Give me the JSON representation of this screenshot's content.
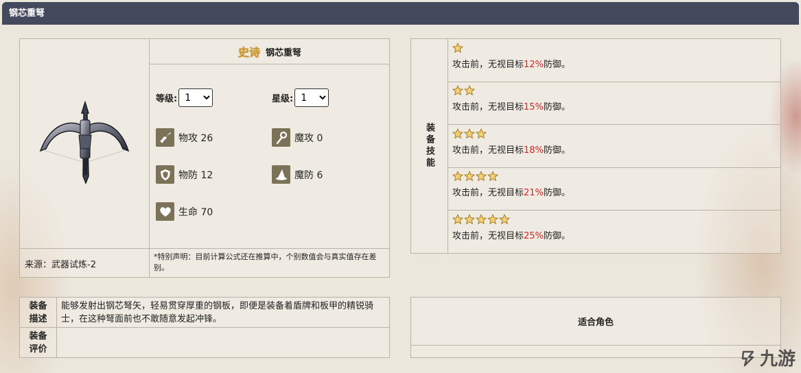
{
  "header": {
    "title": "钢芯重弩"
  },
  "weapon": {
    "rarity_label": "史诗",
    "name": "钢芯重弩",
    "level_label": "等级:",
    "level_value": "1",
    "star_label": "星级:",
    "star_value": "1",
    "stats": [
      {
        "icon": "sword-icon",
        "label": "物攻 26"
      },
      {
        "icon": "staff-icon",
        "label": "魔攻 0"
      },
      {
        "icon": "shield-icon",
        "label": "物防 12"
      },
      {
        "icon": "wizard-hat-icon",
        "label": "魔防 6"
      },
      {
        "icon": "heart-icon",
        "label": "生命 70"
      }
    ],
    "source": "来源：武器试炼-2",
    "note": "*特别声明：目前计算公式还在推算中，个别数值会与真实值存在差别。"
  },
  "skills": {
    "heading": "装备技能",
    "items": [
      {
        "stars": 1,
        "prefix": "攻击前，无视目标",
        "value": "12%",
        "suffix": "防御。"
      },
      {
        "stars": 2,
        "prefix": "攻击前，无视目标",
        "value": "15%",
        "suffix": "防御。"
      },
      {
        "stars": 3,
        "prefix": "攻击前，无视目标",
        "value": "18%",
        "suffix": "防御。"
      },
      {
        "stars": 4,
        "prefix": "攻击前，无视目标",
        "value": "21%",
        "suffix": "防御。"
      },
      {
        "stars": 5,
        "prefix": "攻击前，无视目标",
        "value": "25%",
        "suffix": "防御。"
      }
    ]
  },
  "description": {
    "desc_label": "装备描述",
    "desc_text": "能够发射出钢芯弩矢，轻易贯穿厚重的钢板，即便是装备着盾牌和板甲的精锐骑士，在这种弩面前也不敢随意发起冲锋。",
    "eval_label": "装备评价",
    "eval_text": ""
  },
  "characters": {
    "title": "适合角色"
  },
  "watermark": {
    "text": "九游"
  },
  "colors": {
    "header_bg": "#434a5e",
    "highlight": "#e02020",
    "stat_icon_bg": "#7c7258",
    "rarity": "#d49a2a"
  }
}
